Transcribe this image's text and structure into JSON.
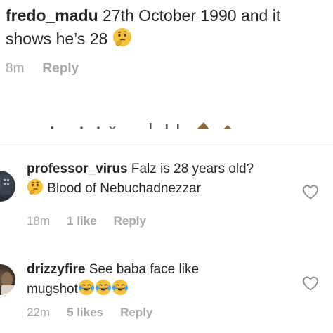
{
  "top_comment": {
    "username": "fredo_madu",
    "text": " 27th October 1990 and it shows he’s 28 ",
    "emoji": "thinking-face",
    "time": "8m",
    "reply_label": "Reply"
  },
  "comments": [
    {
      "username": "professor_virus",
      "text_line1": " Falz is 28 years old?",
      "text_line2": " Blood of Nebuchadnezzar",
      "lead_emoji": "thinking-face",
      "time": "18m",
      "likes": "1 like",
      "reply_label": "Reply",
      "avatar": "avatar"
    },
    {
      "username": "drizzyfire",
      "text_line1": " See baba face like",
      "text_line2": "mugshot",
      "trail_emojis": [
        "face-with-tears-of-joy",
        "face-with-tears-of-joy",
        "face-with-tears-of-joy"
      ],
      "time": "22m",
      "likes": "5 likes",
      "reply_label": "Reply",
      "avatar": "avatar"
    }
  ],
  "colors": {
    "text": "#262626",
    "meta": "#a8a8a8",
    "divider": "#dbdbdb",
    "emoji_yellow": "#f5c33b"
  },
  "icons": [
    "heart-outline-icon",
    "thinking-face-emoji",
    "tears-of-joy-emoji"
  ]
}
